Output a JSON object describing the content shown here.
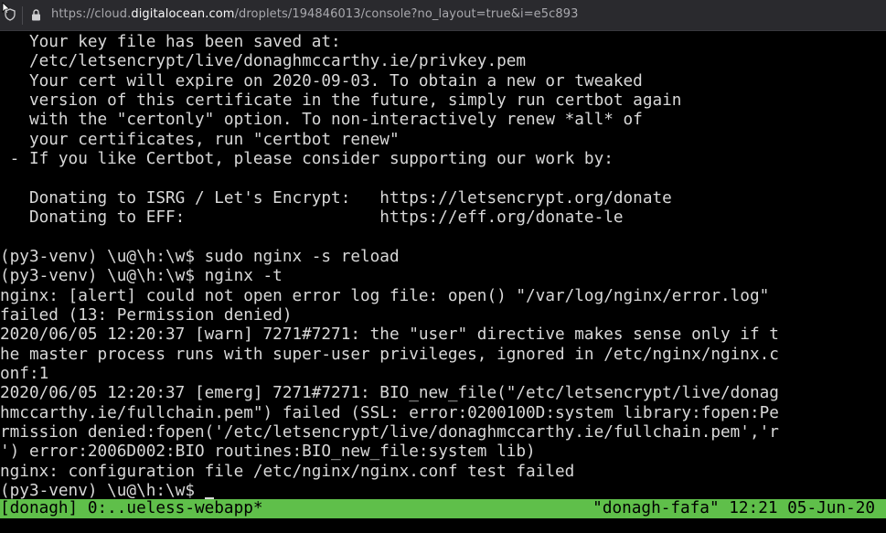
{
  "browser": {
    "url_prefix": "https://cloud.",
    "url_domain": "digitalocean.com",
    "url_suffix": "/droplets/194846013/console?no_layout=true&i=e5c893"
  },
  "terminal": {
    "lines": [
      "   Your key file has been saved at:",
      "   /etc/letsencrypt/live/donaghmccarthy.ie/privkey.pem",
      "   Your cert will expire on 2020-09-03. To obtain a new or tweaked",
      "   version of this certificate in the future, simply run certbot again",
      "   with the \"certonly\" option. To non-interactively renew *all* of",
      "   your certificates, run \"certbot renew\"",
      " - If you like Certbot, please consider supporting our work by:",
      "",
      "   Donating to ISRG / Let's Encrypt:   https://letsencrypt.org/donate",
      "   Donating to EFF:                    https://eff.org/donate-le",
      "",
      "(py3-venv) \\u@\\h:\\w$ sudo nginx -s reload",
      "(py3-venv) \\u@\\h:\\w$ nginx -t",
      "nginx: [alert] could not open error log file: open() \"/var/log/nginx/error.log\"",
      "failed (13: Permission denied)",
      "2020/06/05 12:20:37 [warn] 7271#7271: the \"user\" directive makes sense only if t",
      "he master process runs with super-user privileges, ignored in /etc/nginx/nginx.c",
      "onf:1",
      "2020/06/05 12:20:37 [emerg] 7271#7271: BIO_new_file(\"/etc/letsencrypt/live/donag",
      "hmccarthy.ie/fullchain.pem\") failed (SSL: error:0200100D:system library:fopen:Pe",
      "rmission denied:fopen('/etc/letsencrypt/live/donaghmccarthy.ie/fullchain.pem','r",
      "') error:2006D002:BIO routines:BIO_new_file:system lib)",
      "nginx: configuration file /etc/nginx/nginx.conf test failed",
      "(py3-venv) \\u@\\h:\\w$ "
    ]
  },
  "statusbar": {
    "left": "[donagh] 0:..ueless-webapp*",
    "right": "\"donagh-fafa\" 12:21 05-Jun-20"
  },
  "colors": {
    "terminal_bg": "#000000",
    "terminal_fg": "#d8d8d8",
    "statusbar_bg": "#5fbf4a",
    "urlbar_bg": "#2a2a2e"
  }
}
